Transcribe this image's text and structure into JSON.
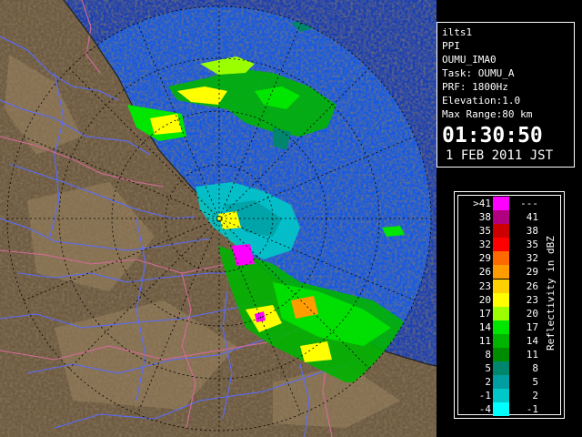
{
  "info": {
    "site": "ilts1",
    "scan_type": "PPI",
    "product": "OUMU_IMA0",
    "task": "Task: OUMU_A",
    "prf": "PRF: 1800Hz",
    "elevation": "Elevation:1.0",
    "max_range": "Max Range:80 km",
    "time": "01:30:50",
    "date": "1 FEB 2011 JST"
  },
  "legend": {
    "unit": "Reflectivity in dBZ",
    "rows": [
      {
        "lower": ">41",
        "upper": "---",
        "color": "#ff00ff"
      },
      {
        "lower": "38",
        "upper": "41",
        "color": "#b00080"
      },
      {
        "lower": "35",
        "upper": "38",
        "color": "#cc0000"
      },
      {
        "lower": "32",
        "upper": "35",
        "color": "#ff0000"
      },
      {
        "lower": "29",
        "upper": "32",
        "color": "#ff6a00"
      },
      {
        "lower": "26",
        "upper": "29",
        "color": "#ff9c00"
      },
      {
        "lower": "23",
        "upper": "26",
        "color": "#ffd000"
      },
      {
        "lower": "20",
        "upper": "23",
        "color": "#ffff00"
      },
      {
        "lower": "17",
        "upper": "20",
        "color": "#9cff00"
      },
      {
        "lower": "14",
        "upper": "17",
        "color": "#00e600"
      },
      {
        "lower": "11",
        "upper": "14",
        "color": "#00b400"
      },
      {
        "lower": "8",
        "upper": "11",
        "color": "#008c00"
      },
      {
        "lower": "5",
        "upper": "8",
        "color": "#00866c"
      },
      {
        "lower": "2",
        "upper": "5",
        "color": "#009ea0"
      },
      {
        "lower": "-1",
        "upper": "2",
        "color": "#00c8c8"
      },
      {
        "lower": "-4",
        "upper": "-1",
        "color": "#00ffff"
      }
    ]
  },
  "colors": {
    "range_disc": "#1459e6",
    "out_of_range": "#1a3fb5",
    "land": "#6e5a40",
    "rivers": "#5a6cff",
    "boundaries": "#d66a9a",
    "coast": "#222222",
    "range_rings": "#000000"
  }
}
